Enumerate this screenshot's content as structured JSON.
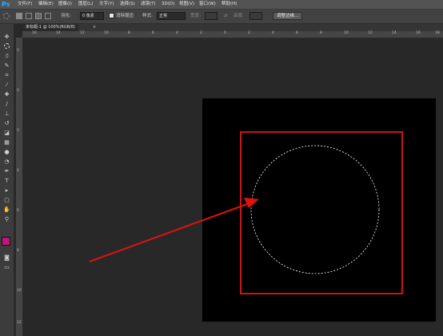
{
  "app": {
    "logo": "Ps"
  },
  "menus": [
    "文件(F)",
    "编辑(E)",
    "图像(I)",
    "图层(L)",
    "文字(Y)",
    "选择(S)",
    "滤镜(T)",
    "3D(D)",
    "视图(V)",
    "窗口(W)",
    "帮助(H)"
  ],
  "options": {
    "feather_label": "羽化:",
    "feather_value": "0 像素",
    "antialias_label": "消除锯齿",
    "style_label": "样式:",
    "style_value": "正常",
    "width_label": "宽度:",
    "height_label": "高度:",
    "refine_button": "调整边缘..."
  },
  "document": {
    "tab_label": "未标题-1 @ 100%(RGB/8)"
  },
  "rulers": {
    "top": [
      "16",
      "14",
      "12",
      "10",
      "8",
      "6",
      "4",
      "2",
      "0",
      "2",
      "4",
      "6",
      "8",
      "10",
      "12",
      "14",
      "16",
      "18"
    ],
    "left": [
      "2",
      "0",
      "2",
      "4",
      "6",
      "8",
      "10",
      "12"
    ]
  },
  "annotation": {
    "rect_color": "#ff1a1a",
    "arrow_color": "#e0120c"
  }
}
